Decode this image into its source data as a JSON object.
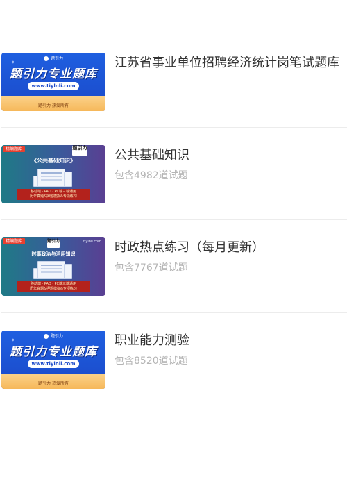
{
  "items": [
    {
      "title": "江苏省事业单位招聘经济统计岗笔试题库",
      "subtitle": "",
      "thumbnail": {
        "style": "brand-banner",
        "logo_text": "题引力",
        "headline": "题引力专业题库",
        "url": "www.tiylnli.com",
        "slogan": "题引力 热爱所有"
      }
    },
    {
      "title": "公共基础知识",
      "subtitle": "包含4982道试题",
      "thumbnail": {
        "style": "course-card",
        "tag": "精编题库",
        "corner_mark": "题引力",
        "corner_url": "",
        "course_title": "《公共基础知识》",
        "footer_line1": "移动端 · PAD · PC端三端通用",
        "footer_line2": "历年真题&押题模拟&专项练习"
      }
    },
    {
      "title": "时政热点练习（每月更新）",
      "subtitle": "包含7767道试题",
      "thumbnail": {
        "style": "course-card",
        "tag": "精编题库",
        "corner_mark": "题引力",
        "corner_url": "tiylnli.com",
        "course_title": "时事政治与活用知识",
        "footer_line1": "移动端 · PAD · PC端三端通用",
        "footer_line2": "历年真题&押题模拟&专项练习"
      }
    },
    {
      "title": "职业能力测验",
      "subtitle": "包含8520道试题",
      "thumbnail": {
        "style": "brand-banner",
        "logo_text": "题引力",
        "headline": "题引力专业题库",
        "url": "www.tiylnli.com",
        "slogan": "题引力 热爱所有"
      }
    }
  ]
}
